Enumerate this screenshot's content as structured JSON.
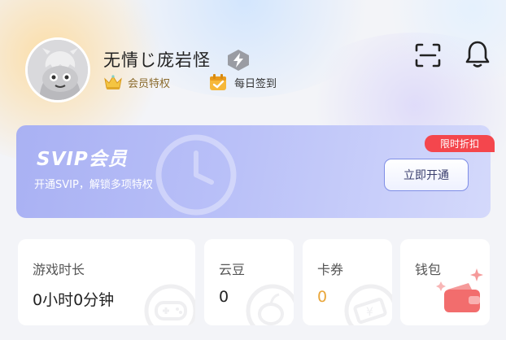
{
  "profile": {
    "username": "无情じ庞岩怪",
    "vip_label": "会员特权",
    "checkin_label": "每日签到"
  },
  "svip": {
    "title": "SVIP会员",
    "subtitle": "开通SVIP，解锁多项特权",
    "promo_tag": "限时折扣",
    "button_label": "立即开通"
  },
  "stats": [
    {
      "label": "游戏时长",
      "value": "0小时0分钟"
    },
    {
      "label": "云豆",
      "value": "0"
    },
    {
      "label": "卡券",
      "value": "0"
    },
    {
      "label": "钱包",
      "value": ""
    }
  ],
  "icons": [
    "avatar-placeholder",
    "lightning-badge-icon",
    "crown-icon",
    "calendar-check-icon",
    "scan-icon",
    "bell-icon",
    "clock-icon",
    "gamepad-icon",
    "bean-icon",
    "ticket-icon",
    "wallet-icon"
  ],
  "colors": {
    "promo_red": "#f4464d",
    "svip_gradient_start": "#a9b1f3",
    "coupon_value": "#e9a63a",
    "wallet_red": "#f46a6a"
  }
}
